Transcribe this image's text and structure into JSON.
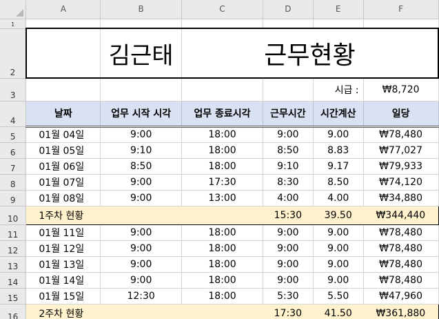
{
  "columns": [
    "A",
    "B",
    "C",
    "D",
    "E",
    "F"
  ],
  "title": {
    "name": "김근태",
    "subtitle": "근무현황"
  },
  "wage": {
    "label": "시급 :",
    "value": "₩8,720"
  },
  "headers": [
    "날짜",
    "업무 시작 시각",
    "업무 종료시각",
    "근무시간",
    "시간계산",
    "일당"
  ],
  "row_numbers": {
    "r1": "1",
    "r2": "2",
    "r3": "3",
    "r4": "4"
  },
  "week1": [
    {
      "row": "5",
      "date": "01월 04일",
      "start": "9:00",
      "end": "18:00",
      "hours": "9:00",
      "calc": "9.00",
      "pay": "₩78,480"
    },
    {
      "row": "6",
      "date": "01월 05일",
      "start": "9:10",
      "end": "18:00",
      "hours": "8:50",
      "calc": "8.83",
      "pay": "₩77,027"
    },
    {
      "row": "7",
      "date": "01월 06일",
      "start": "8:50",
      "end": "18:00",
      "hours": "9:10",
      "calc": "9.17",
      "pay": "₩79,933"
    },
    {
      "row": "8",
      "date": "01월 07일",
      "start": "9:00",
      "end": "17:30",
      "hours": "8:30",
      "calc": "8.50",
      "pay": "₩74,120"
    },
    {
      "row": "9",
      "date": "01월 08일",
      "start": "9:00",
      "end": "13:00",
      "hours": "4:00",
      "calc": "4.00",
      "pay": "₩34,880"
    }
  ],
  "week1_total": {
    "row": "10",
    "label": "1주차 현황",
    "hours": "15:30",
    "calc": "39.50",
    "pay": "₩344,440"
  },
  "week2": [
    {
      "row": "11",
      "date": "01월 11일",
      "start": "9:00",
      "end": "18:00",
      "hours": "9:00",
      "calc": "9.00",
      "pay": "₩78,480"
    },
    {
      "row": "12",
      "date": "01월 12일",
      "start": "9:00",
      "end": "18:00",
      "hours": "9:00",
      "calc": "9.00",
      "pay": "₩78,480"
    },
    {
      "row": "13",
      "date": "01월 13일",
      "start": "9:00",
      "end": "18:00",
      "hours": "9:00",
      "calc": "9.00",
      "pay": "₩78,480"
    },
    {
      "row": "14",
      "date": "01월 14일",
      "start": "9:00",
      "end": "18:00",
      "hours": "9:00",
      "calc": "9.00",
      "pay": "₩78,480"
    },
    {
      "row": "15",
      "date": "01월 15일",
      "start": "12:30",
      "end": "18:00",
      "hours": "5:30",
      "calc": "5.50",
      "pay": "₩47,960"
    }
  ],
  "week2_total": {
    "row": "16",
    "label": "2주차 현황",
    "hours": "17:30",
    "calc": "41.50",
    "pay": "₩361,880"
  }
}
